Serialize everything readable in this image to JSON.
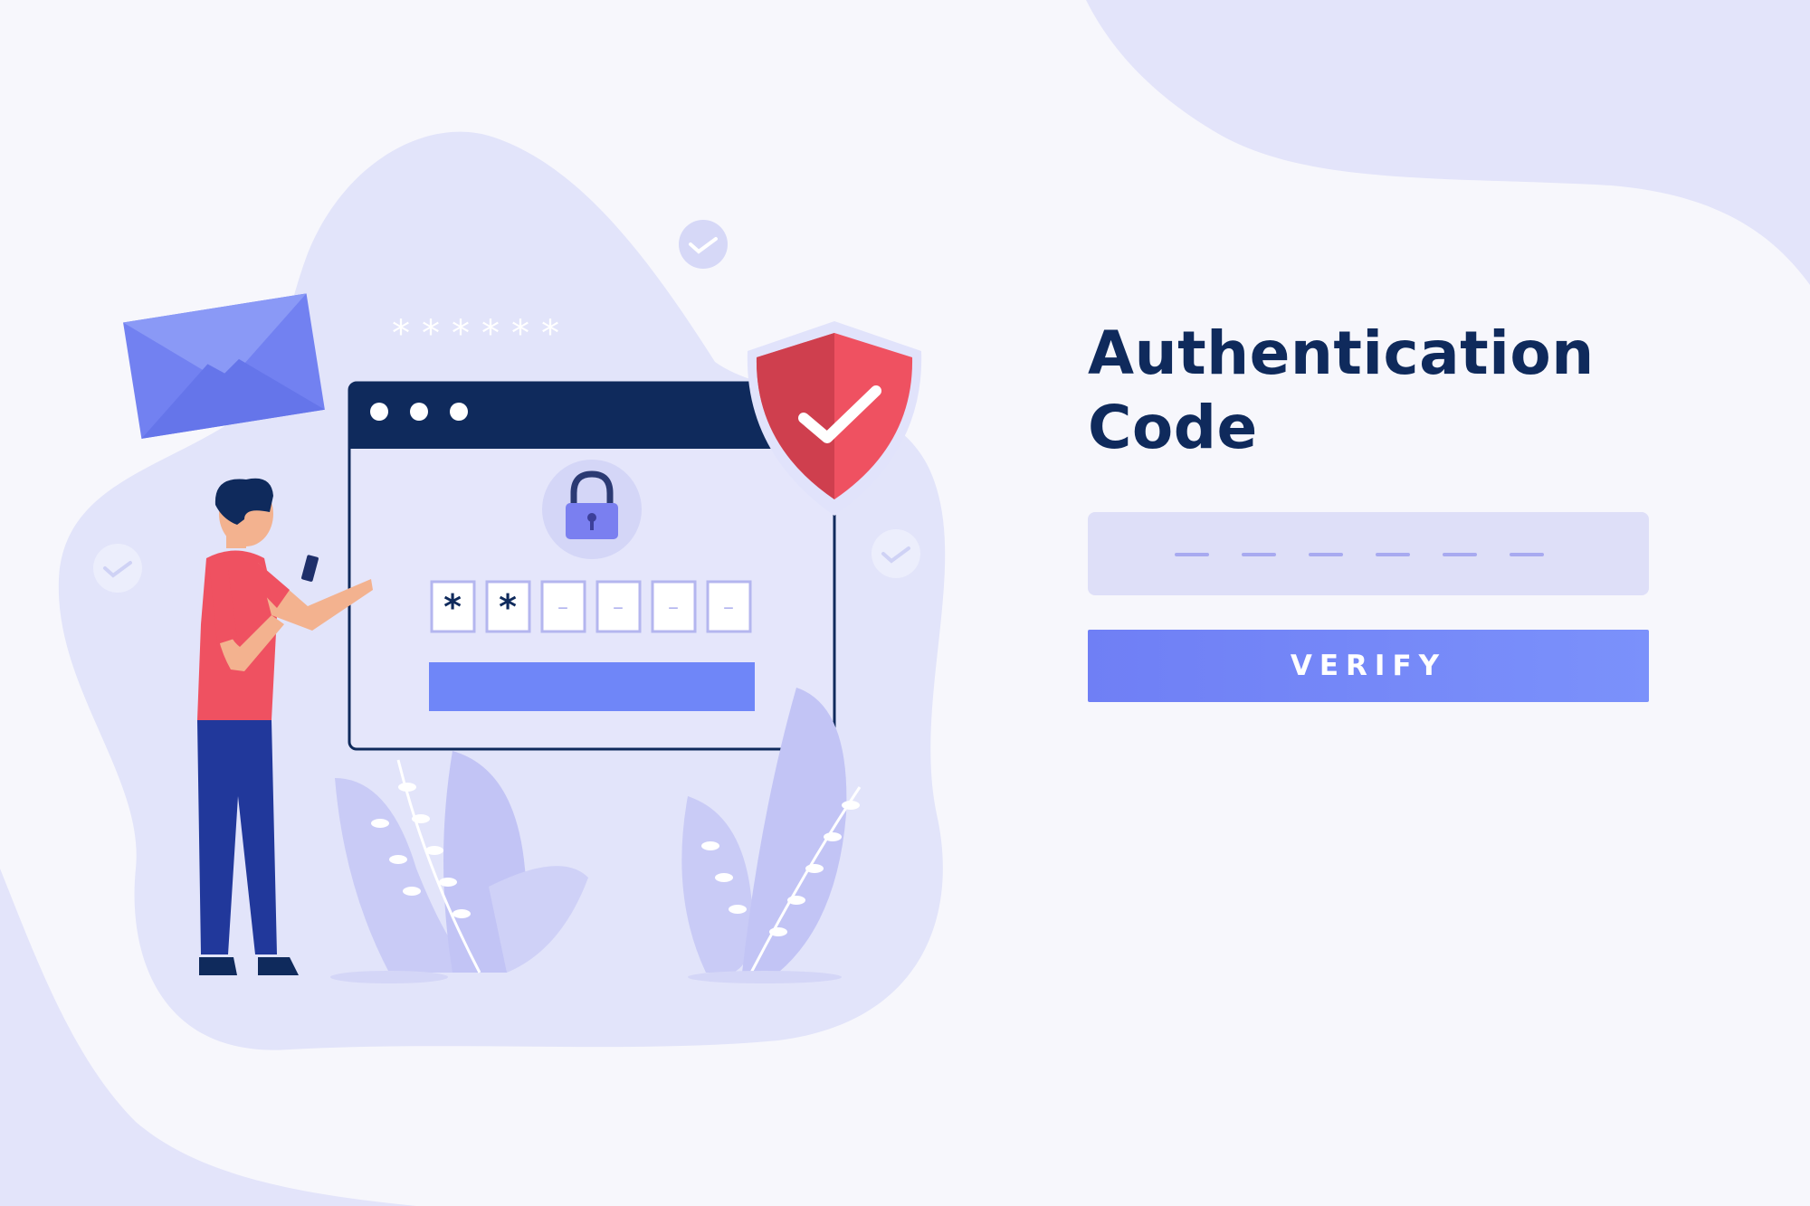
{
  "auth": {
    "title_line1": "Authentication",
    "title_line2": "Code",
    "code_length": 6,
    "verify_label": "VERIFY"
  },
  "illustration": {
    "asterisks": "******",
    "browser": {
      "window_dots": 3,
      "code_boxes": [
        "*",
        "*",
        "–",
        "–",
        "–",
        "–"
      ]
    },
    "icons": [
      "mail-envelope-icon",
      "shield-check-icon",
      "padlock-icon",
      "check-badge-icon"
    ]
  },
  "colors": {
    "title": "#0f2a5c",
    "accent": "#6f7ff5",
    "shield": "#e9505f",
    "blob": "#e2e4fa",
    "background": "#f7f7fc"
  }
}
